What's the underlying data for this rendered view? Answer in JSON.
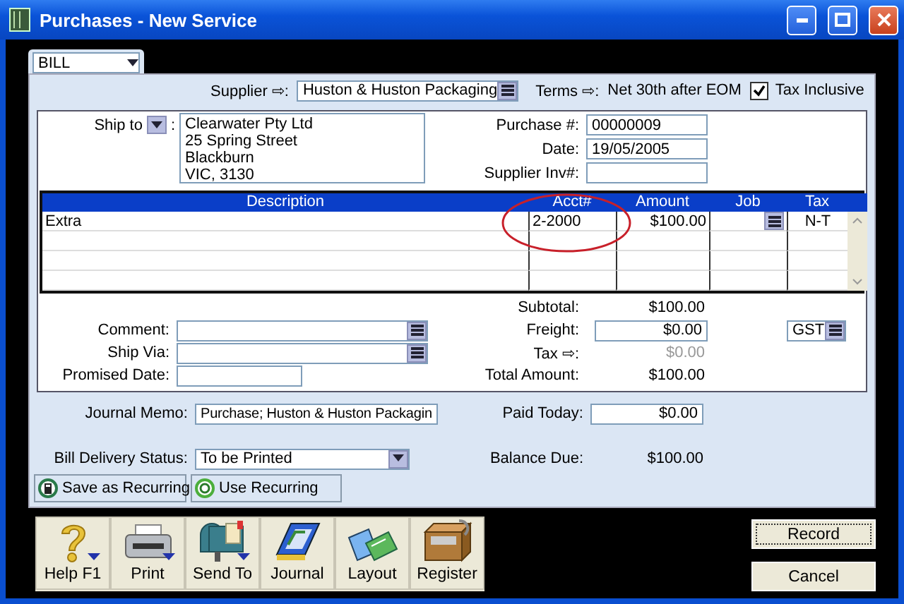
{
  "window": {
    "title": "Purchases - New Service"
  },
  "layout_selector": {
    "value": "BILL"
  },
  "header": {
    "supplier_label": "Supplier ⇨:",
    "supplier": "Huston & Huston Packaging",
    "terms_label": "Terms ⇨:",
    "terms": "Net 30th after EOM",
    "tax_inclusive": {
      "label": "Tax Inclusive",
      "checked": true
    }
  },
  "ship_to": {
    "label": "Ship to",
    "separator": ":",
    "address": [
      "Clearwater Pty Ltd",
      "25 Spring Street",
      "Blackburn",
      "VIC, 3130"
    ]
  },
  "details": [
    {
      "label": "Purchase #:",
      "value": "00000009"
    },
    {
      "label": "Date:",
      "value": "19/05/2005"
    },
    {
      "label": "Supplier Inv#:"
    }
  ],
  "table": {
    "columns": [
      "Description",
      "Acct#",
      "Amount",
      "Job",
      "Tax"
    ],
    "rows": [
      {
        "description": "Extra",
        "acct": "2-2000",
        "amount": "$100.00",
        "tax": "N-T",
        "job_dropdown": true
      }
    ]
  },
  "extra_fields": [
    {
      "label": "Comment:",
      "kind": "combo"
    },
    {
      "label": "Ship Via:",
      "kind": "combo"
    },
    {
      "label": "Promised Date:",
      "kind": "text"
    }
  ],
  "totals": [
    {
      "label": "Subtotal:",
      "value": "$100.00",
      "kind": "plain"
    },
    {
      "label": "Freight:",
      "value": "$0.00",
      "kind": "field"
    },
    {
      "label": "Tax ⇨:",
      "value": "$0.00",
      "kind": "disabled"
    },
    {
      "label": "Total Amount:",
      "value": "$100.00",
      "kind": "plain"
    }
  ],
  "tax_code": "GST",
  "journal_memo": {
    "label": "Journal Memo:",
    "value": "Purchase; Huston & Huston Packagin"
  },
  "paid_today": {
    "label": "Paid Today:",
    "value": "$0.00"
  },
  "delivery_status": {
    "label": "Bill Delivery Status:",
    "value": "To be Printed"
  },
  "balance_due": {
    "label": "Balance Due:",
    "value": "$100.00"
  },
  "recurring_buttons": [
    {
      "label": "Save as Recurring",
      "kind": "save"
    },
    {
      "label": "Use Recurring",
      "kind": "use"
    }
  ],
  "toolbar": [
    {
      "label": "Help F1",
      "kind": "help",
      "menu": true
    },
    {
      "label": "Print",
      "kind": "print",
      "menu": true
    },
    {
      "label": "Send To",
      "kind": "send",
      "menu": true
    },
    {
      "label": "Journal",
      "kind": "journal",
      "menu": false
    },
    {
      "label": "Layout",
      "kind": "layout",
      "menu": false
    },
    {
      "label": "Register",
      "kind": "register",
      "menu": false
    }
  ],
  "actions": [
    "Record",
    "Cancel"
  ]
}
